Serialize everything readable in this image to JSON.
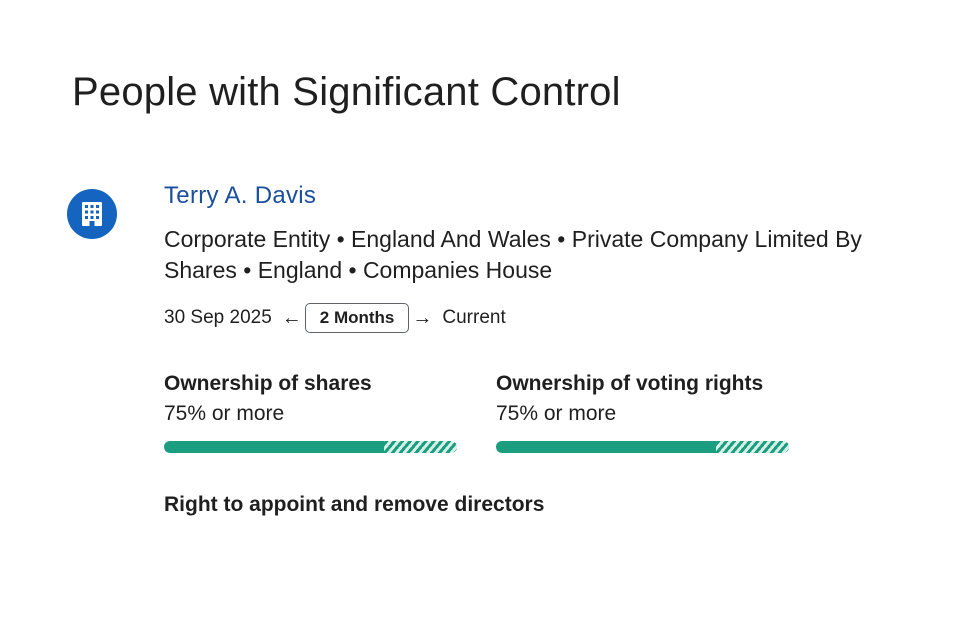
{
  "page": {
    "title": "People with Significant Control"
  },
  "psc": {
    "name": "Terry A. Davis",
    "details": "Corporate Entity • England And Wales • Private Company Limited By Shares • England • Companies House",
    "icon": "building-icon",
    "icon_color": "#1565c0",
    "name_color": "#1a4f9c",
    "timeline": {
      "start": "30 Sep 2025",
      "duration": "2 Months",
      "end": "Current"
    },
    "ownership": [
      {
        "label": "Ownership of shares",
        "value": "75% or more",
        "min_fraction": 0.75
      },
      {
        "label": "Ownership of voting rights",
        "value": "75% or more",
        "min_fraction": 0.75
      }
    ],
    "bar_color": "#1a9e7f",
    "appoint_label": "Right to appoint and remove directors"
  }
}
